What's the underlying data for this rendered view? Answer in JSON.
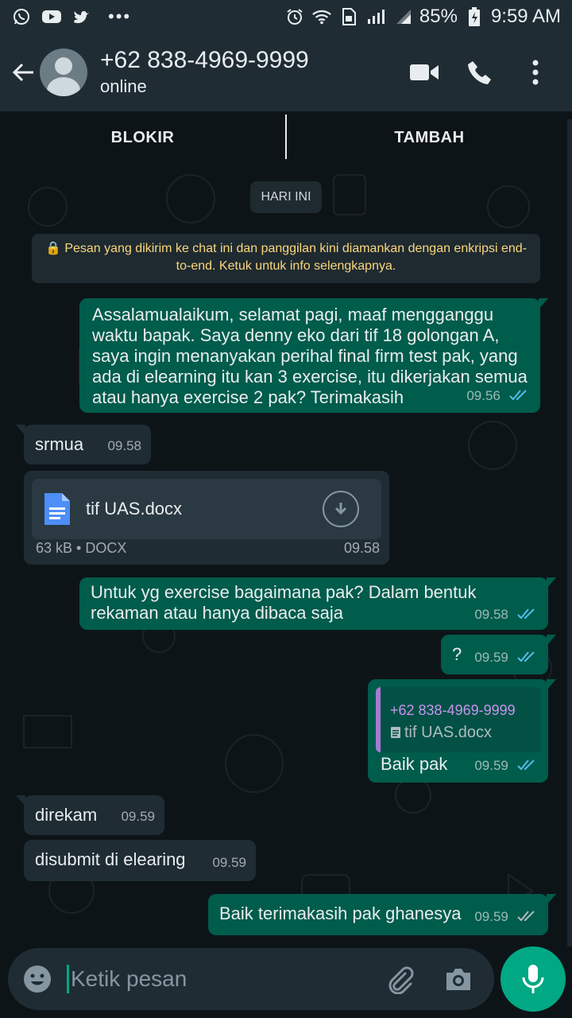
{
  "status_bar": {
    "battery": "85%",
    "time": "9:59 AM",
    "notification_icons": [
      "whatsapp-icon",
      "youtube-icon",
      "twitter-icon"
    ],
    "more": "•••"
  },
  "header": {
    "contact": "+62 838-4969-9999",
    "status": "online"
  },
  "top_actions": {
    "block": "BLOKIR",
    "add": "TAMBAH"
  },
  "day_chip": "HARI INI",
  "encryption_notice": "🔒 Pesan yang dikirim ke chat ini dan panggilan kini diamankan dengan enkripsi end-to-end. Ketuk untuk info selengkapnya.",
  "messages": [
    {
      "direction": "out",
      "text": "Assalamualaikum, selamat pagi, maaf mengganggu waktu bapak. Saya denny eko dari tif 18 golongan A, saya ingin menanyakan perihal final firm test pak, yang ada di elearning itu kan 3 exercise, itu dikerjakan semua atau hanya exercise 2 pak? Terimakasih",
      "time": "09.56",
      "status": "read"
    },
    {
      "direction": "in",
      "text": "srmua",
      "time": "09.58"
    },
    {
      "direction": "in",
      "type": "document",
      "filename": "tif UAS.docx",
      "meta": "63 kB • DOCX",
      "time": "09.58"
    },
    {
      "direction": "out",
      "text": "Untuk yg exercise bagaimana pak? Dalam bentuk rekaman atau hanya dibaca saja",
      "time": "09.58",
      "status": "read"
    },
    {
      "direction": "out",
      "text": "?",
      "time": "09.59",
      "status": "read"
    },
    {
      "direction": "out",
      "text": "Baik pak",
      "time": "09.59",
      "status": "read",
      "quote": {
        "author": "+62 838-4969-9999",
        "file": "tif UAS.docx"
      }
    },
    {
      "direction": "in",
      "text": "direkam",
      "time": "09.59"
    },
    {
      "direction": "in",
      "text": "disubmit di elearing",
      "time": "09.59"
    },
    {
      "direction": "out",
      "text": "Baik terimakasih pak ghanesya",
      "time": "09.59",
      "status": "delivered"
    }
  ],
  "composer": {
    "placeholder": "Ketik pesan"
  },
  "colors": {
    "outgoing_bubble": "#005c4b",
    "incoming_bubble": "#1f2c34",
    "accent": "#00a884",
    "read_ticks": "#53bdeb"
  }
}
